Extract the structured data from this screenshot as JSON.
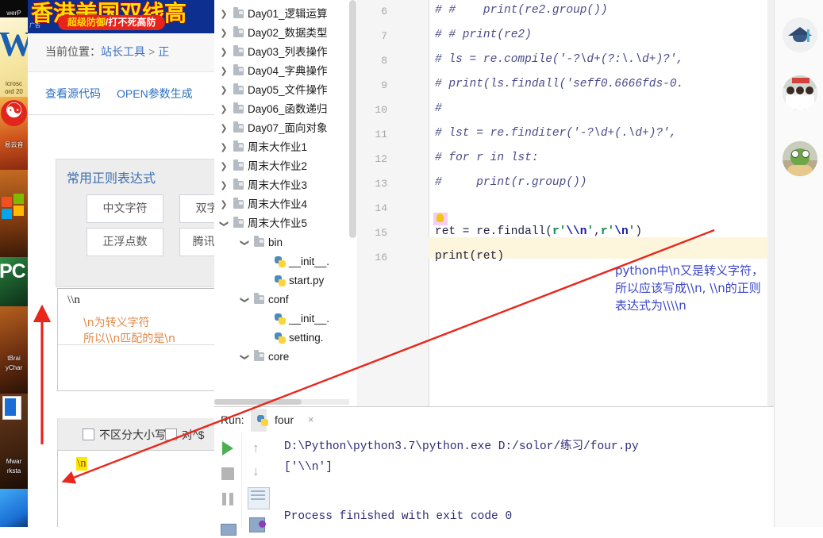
{
  "desktop": {
    "icons": [
      {
        "name": "powerpoint",
        "label": "werP"
      },
      {
        "name": "word",
        "label": "icrosc",
        "label2": "ord 20"
      },
      {
        "name": "netease-music",
        "label": "易云音"
      },
      {
        "name": "office",
        "label": ""
      },
      {
        "name": "pc-manager",
        "label": "PC"
      },
      {
        "name": "jetbrains-pycharm",
        "label": "tBrai",
        "label2": "yChar"
      },
      {
        "name": "vmware-workstation",
        "label": "Mwar",
        "label2": "rksta"
      },
      {
        "name": "misc",
        "label": ""
      }
    ],
    "word_logo": "W",
    "pc_logo": "PC"
  },
  "website": {
    "ad": {
      "headline": "香港美国双线高",
      "pill_left": "超级防御",
      "pill_sep": "/",
      "pill_right": "打不死高防",
      "tag": "广告"
    },
    "breadcrumb": {
      "prefix": "当前位置：",
      "item1": "站长工具",
      "sep": ">",
      "item2": "正"
    },
    "links": {
      "view_source": "查看源代码",
      "open_params": "OPEN参数生成"
    },
    "regex_panel": {
      "title": "常用正则表达式",
      "buttons": [
        "中文字符",
        "双字节字",
        "正浮点数",
        "腾讯QQ号"
      ]
    },
    "regex_input": {
      "value": "\\\\n"
    },
    "annotations_orange": [
      "\\n为转义字符",
      "所以\\\\n匹配的是\\n"
    ],
    "options": {
      "ignore_case": "不区分大小写",
      "multiline": "对^$"
    },
    "result": {
      "match": "\\n"
    }
  },
  "ide": {
    "project_tree": [
      {
        "label": "Day01_逻辑运算",
        "type": "folder",
        "expanded": false,
        "depth": 0
      },
      {
        "label": "Day02_数据类型",
        "type": "folder",
        "expanded": false,
        "depth": 0
      },
      {
        "label": "Day03_列表操作",
        "type": "folder",
        "expanded": false,
        "depth": 0
      },
      {
        "label": "Day04_字典操作",
        "type": "folder",
        "expanded": false,
        "depth": 0
      },
      {
        "label": "Day05_文件操作",
        "type": "folder",
        "expanded": false,
        "depth": 0
      },
      {
        "label": "Day06_函数递归",
        "type": "folder",
        "expanded": false,
        "depth": 0
      },
      {
        "label": "Day07_面向对象",
        "type": "folder",
        "expanded": false,
        "depth": 0
      },
      {
        "label": "周末大作业1",
        "type": "folder",
        "expanded": false,
        "depth": 0
      },
      {
        "label": "周末大作业2",
        "type": "folder",
        "expanded": false,
        "depth": 0
      },
      {
        "label": "周末大作业3",
        "type": "folder",
        "expanded": false,
        "depth": 0
      },
      {
        "label": "周末大作业4",
        "type": "folder",
        "expanded": false,
        "depth": 0
      },
      {
        "label": "周末大作业5",
        "type": "folder",
        "expanded": true,
        "depth": 0
      },
      {
        "label": "bin",
        "type": "folder",
        "expanded": true,
        "depth": 1
      },
      {
        "label": "__init__.",
        "type": "python",
        "expanded": null,
        "depth": 2
      },
      {
        "label": "start.py",
        "type": "python",
        "expanded": null,
        "depth": 2
      },
      {
        "label": "conf",
        "type": "folder",
        "expanded": true,
        "depth": 1
      },
      {
        "label": "__init__.",
        "type": "python",
        "expanded": null,
        "depth": 2
      },
      {
        "label": "setting.",
        "type": "python",
        "expanded": null,
        "depth": 2
      },
      {
        "label": "core",
        "type": "folder",
        "expanded": true,
        "depth": 1
      }
    ],
    "editor": {
      "first_line_number": 6,
      "lines": [
        {
          "n": 6,
          "kind": "comment",
          "text": "# #    print(re2.group())"
        },
        {
          "n": 7,
          "kind": "comment",
          "text": "# # print(re2)"
        },
        {
          "n": 8,
          "kind": "comment",
          "text": "# ls = re.compile('-?\\d+(?:\\.\\d+)?',"
        },
        {
          "n": 9,
          "kind": "comment",
          "text": "# print(ls.findall('seff0.6666fds-0."
        },
        {
          "n": 10,
          "kind": "comment",
          "text": "#"
        },
        {
          "n": 11,
          "kind": "comment",
          "text": "# lst = re.finditer('-?\\d+(.\\d+)?',"
        },
        {
          "n": 12,
          "kind": "comment",
          "text": "# for r in lst:"
        },
        {
          "n": 13,
          "kind": "comment",
          "text": "#     print(r.group())"
        },
        {
          "n": 14,
          "kind": "blank",
          "text": ""
        },
        {
          "n": 15,
          "kind": "code",
          "pre": "r",
          "mid": "et = re.findall(",
          "s1": "r'\\\\n'",
          "comma": ",",
          "s2": "r'\\n'",
          "post": ")"
        },
        {
          "n": 16,
          "kind": "code2",
          "p1": "print",
          "p2": "(",
          "p3": "ret",
          "p4": ")"
        }
      ]
    },
    "annotation_note": {
      "line1": "python中\\n又是转义字符，",
      "line2": "所以应该写成\\\\n, \\\\n的正则",
      "line3": "表达式为\\\\\\\\n"
    },
    "run_panel": {
      "label": "Run:",
      "tab_name": "four",
      "close": "×",
      "console_lines": [
        "D:\\Python\\python3.7\\python.exe D:/solor/练习/four.py",
        "['\\\\n']",
        "",
        "Process finished with exit code 0"
      ],
      "buttons": {
        "run": "run-button",
        "stop": "stop-button",
        "pause": "pause-button",
        "up": "↑",
        "down": "↓",
        "wrap": "soft-wrap-button",
        "print": "print-button",
        "bottom": "scroll-to-end-button"
      }
    }
  },
  "right_rail": {
    "avatars": [
      "graduation-cap-avatar",
      "group-photo-avatar",
      "frog-avatar"
    ]
  },
  "colors": {
    "accent_blue": "#3b46c8",
    "arrow_red": "#e8261c",
    "highlight_yellow": "#ffe800",
    "note_orange": "#e08a4a",
    "string_green": "#128c4b"
  }
}
